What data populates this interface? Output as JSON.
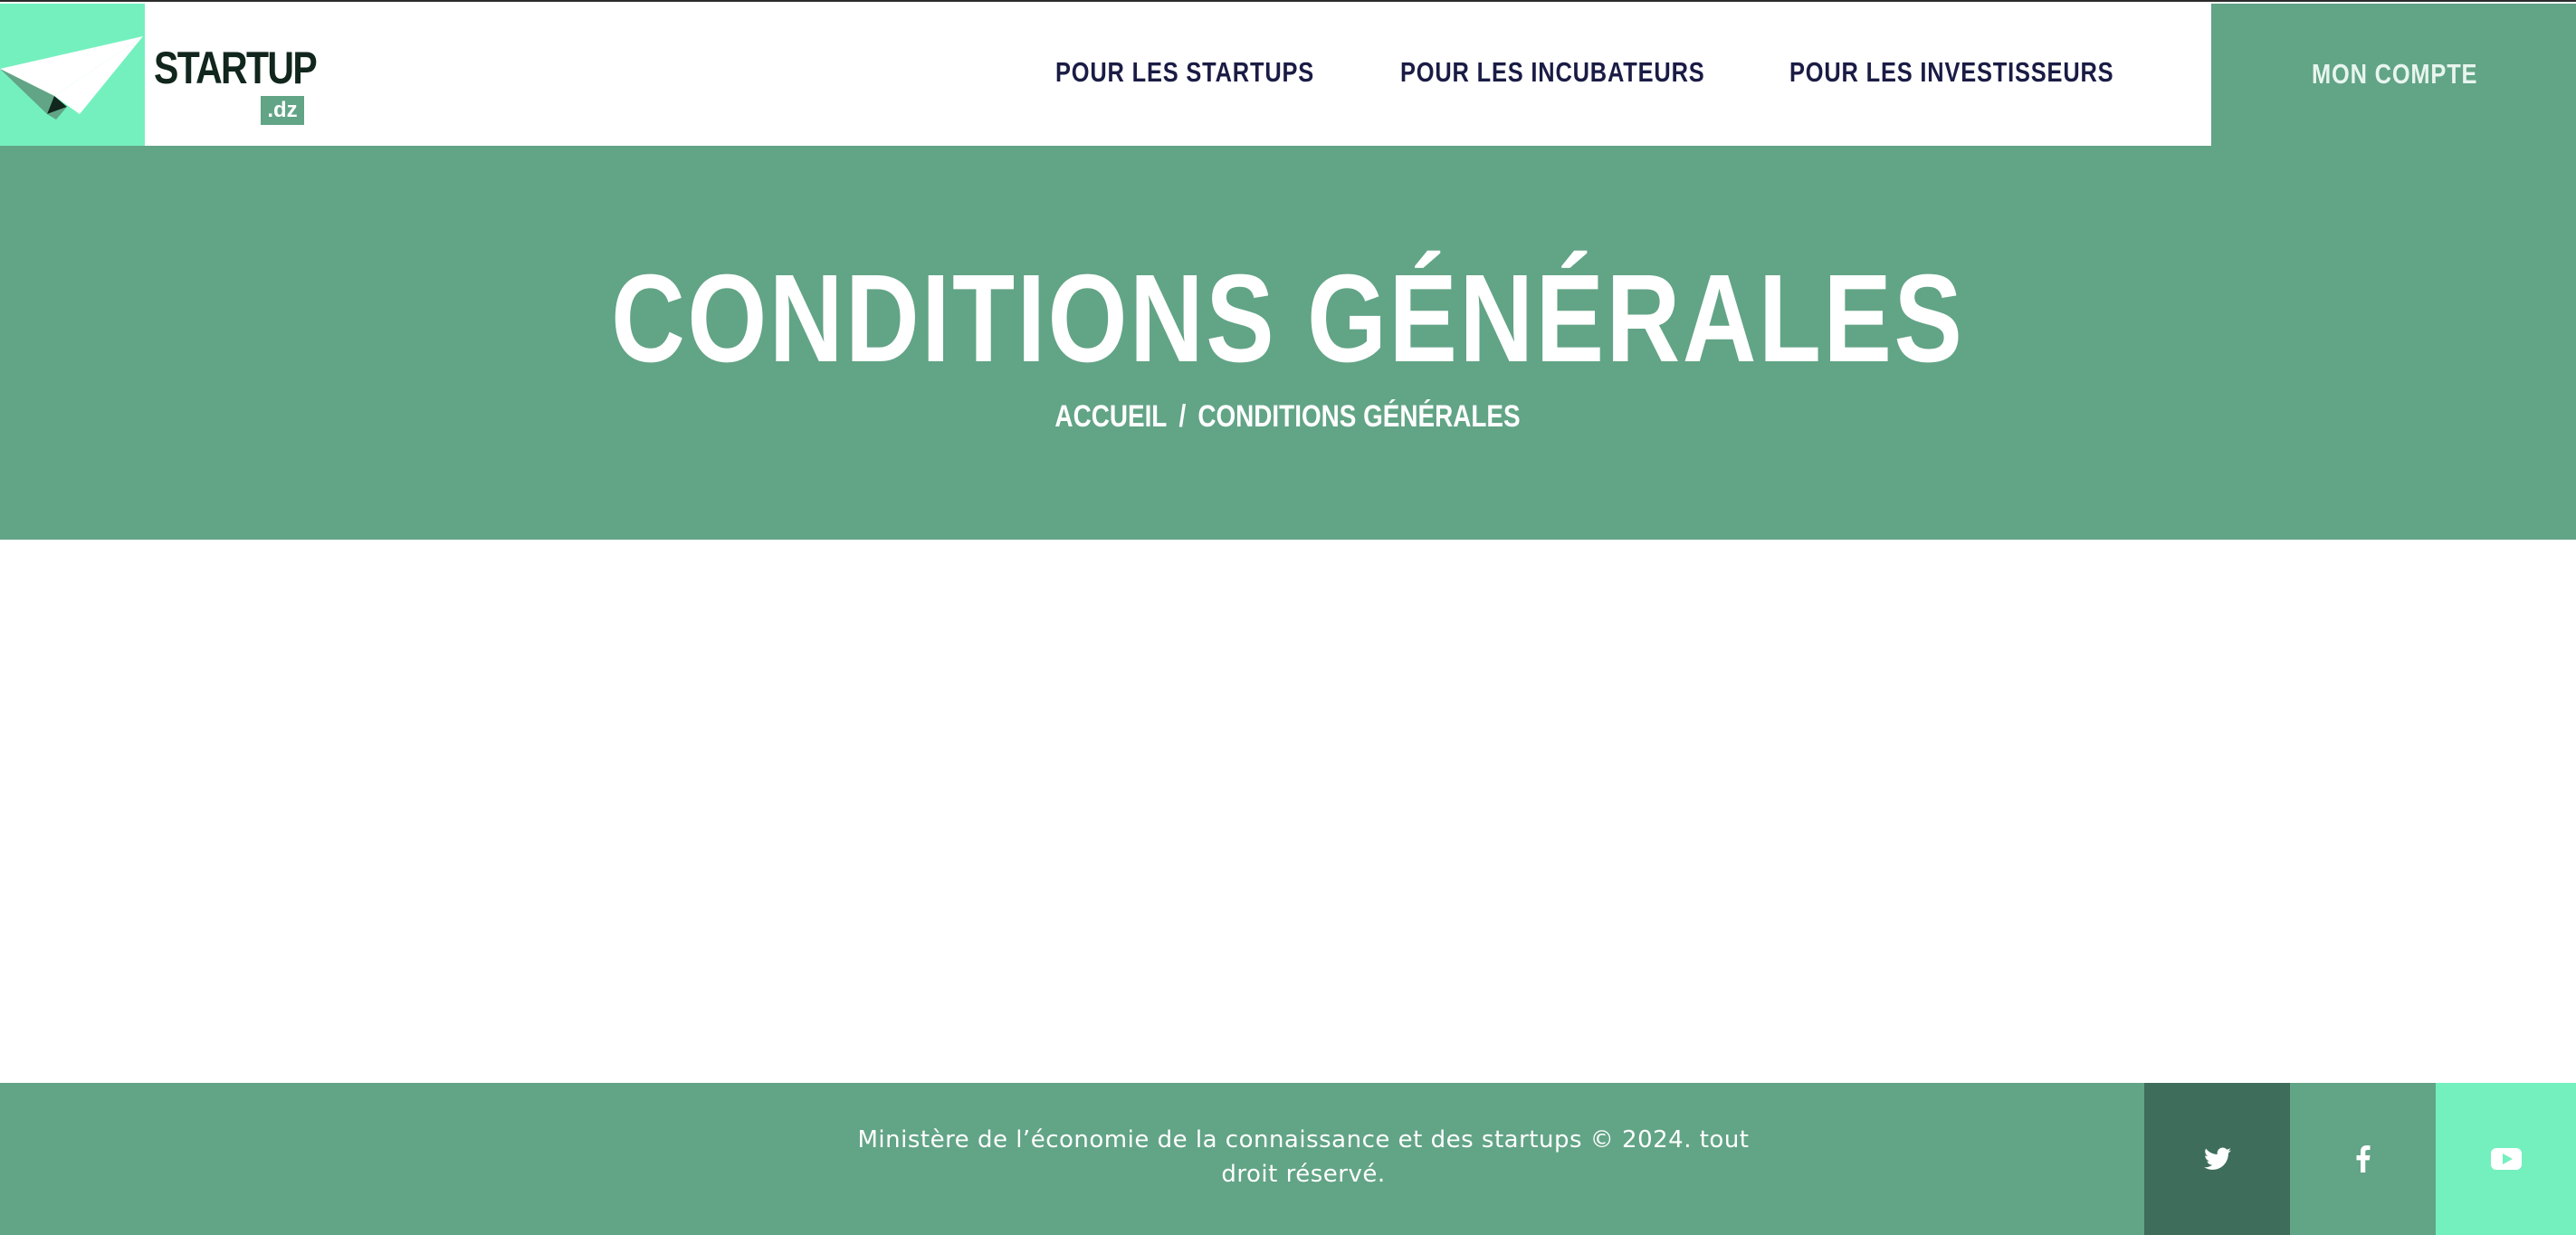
{
  "brand": {
    "name": "STARTUP",
    "suffix": ".dz"
  },
  "nav": {
    "items": [
      {
        "label": "POUR LES STARTUPS"
      },
      {
        "label": "POUR LES INCUBATEURS"
      },
      {
        "label": "POUR LES INVESTISSEURS"
      }
    ],
    "account_label": "MON COMPTE"
  },
  "hero": {
    "title": "CONDITIONS GÉNÉRALES",
    "breadcrumb": {
      "home": "ACCUEIL",
      "separator": "/",
      "current": "CONDITIONS GÉNÉRALES"
    }
  },
  "footer": {
    "text_line1": "Ministère de l’économie de la connaissance et des startups © 2024. tout",
    "text_line2": "droit réservé.",
    "social": [
      {
        "icon": "twitter-icon"
      },
      {
        "icon": "facebook-icon"
      },
      {
        "icon": "youtube-icon"
      }
    ]
  },
  "colors": {
    "primary": "#62a486",
    "accent": "#74f0bf",
    "dark": "#3e6d5b",
    "nav_text": "#1a1c45"
  }
}
